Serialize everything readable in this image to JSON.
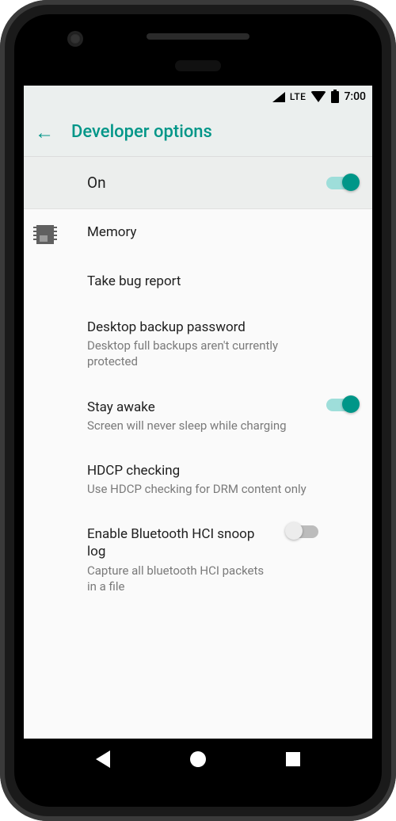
{
  "statusbar": {
    "network_label": "LTE",
    "clock": "7:00"
  },
  "appbar": {
    "title": "Developer options"
  },
  "master_toggle": {
    "label": "On",
    "state": "on"
  },
  "items": [
    {
      "icon": "chip-icon",
      "title": "Memory",
      "subtitle": null,
      "switch": null
    },
    {
      "icon": null,
      "title": "Take bug report",
      "subtitle": null,
      "switch": null
    },
    {
      "icon": null,
      "title": "Desktop backup password",
      "subtitle": "Desktop full backups aren't currently protected",
      "switch": null
    },
    {
      "icon": null,
      "title": "Stay awake",
      "subtitle": "Screen will never sleep while charging",
      "switch": "on"
    },
    {
      "icon": null,
      "title": "HDCP checking",
      "subtitle": "Use HDCP checking for DRM content only",
      "switch": null
    },
    {
      "icon": null,
      "title": "Enable Bluetooth HCI snoop log",
      "subtitle": "Capture all bluetooth HCI packets in a file",
      "switch": "off"
    }
  ]
}
